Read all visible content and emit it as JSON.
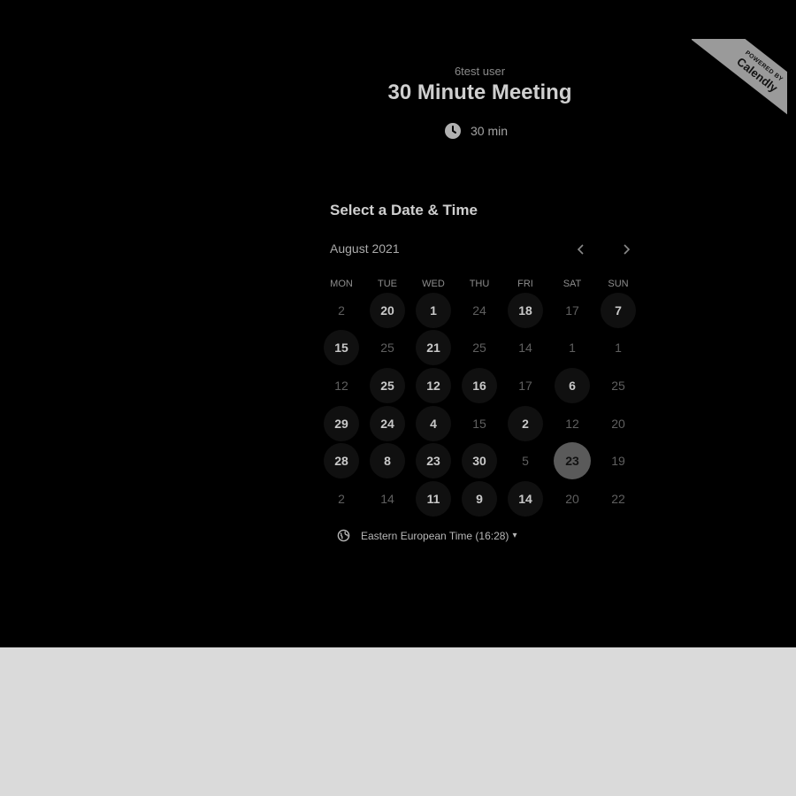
{
  "header": {
    "owner": "6test user",
    "title": "30 Minute Meeting",
    "duration": "30 min"
  },
  "ribbon": {
    "powered_by": "POWERED BY",
    "brand": "Calendly"
  },
  "calendar": {
    "section_title": "Select a Date & Time",
    "month": "August 2021",
    "prev_icon": "chevron-left-icon",
    "next_icon": "chevron-right-icon",
    "weekdays": [
      "MON",
      "TUE",
      "WED",
      "THU",
      "FRI",
      "SAT",
      "SUN"
    ],
    "weeks": [
      [
        "2",
        "20",
        "1",
        "24",
        "18",
        "17",
        "7"
      ],
      [
        "15",
        "25",
        "21",
        "25",
        "14",
        "1",
        "1"
      ],
      [
        "12",
        "25",
        "12",
        "16",
        "17",
        "6",
        "25"
      ],
      [
        "29",
        "24",
        "4",
        "15",
        "2",
        "12",
        "20"
      ],
      [
        "28",
        "8",
        "23",
        "30",
        "5",
        "23",
        "19"
      ],
      [
        "2",
        "14",
        "11",
        "9",
        "14",
        "20",
        "22"
      ]
    ],
    "availability": [
      [
        0,
        1,
        1,
        0,
        1,
        0,
        1
      ],
      [
        1,
        0,
        1,
        0,
        0,
        0,
        0
      ],
      [
        0,
        1,
        1,
        1,
        0,
        1,
        0
      ],
      [
        1,
        1,
        1,
        0,
        1,
        0,
        0
      ],
      [
        1,
        1,
        1,
        1,
        0,
        2,
        0
      ],
      [
        0,
        0,
        1,
        1,
        1,
        0,
        0
      ]
    ]
  },
  "timezone": {
    "label": "Eastern European Time (16:28)",
    "icon": "globe-icon"
  },
  "colors": {
    "panel_bg": "#000000",
    "page_bg": "#dadada",
    "selected_day_bg": "#5a5a5a",
    "ribbon_bg": "#9a9a9a"
  }
}
